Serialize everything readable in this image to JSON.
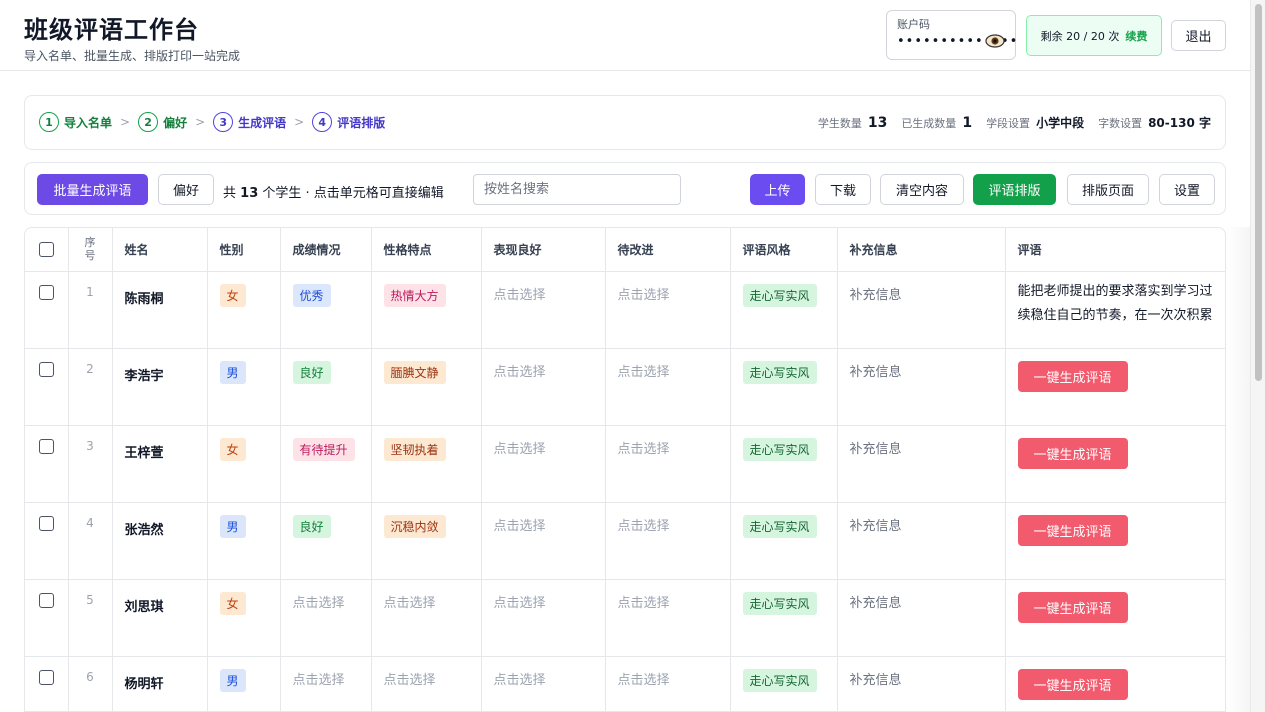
{
  "header": {
    "title": "班级评语工作台",
    "subtitle": "导入名单、批量生成、排版打印一站完成",
    "account_label": "账户码",
    "account_value": "••••••••••••••",
    "quota_text": "剩余 20 / 20 次",
    "renew_label": "续费",
    "logout_label": "退出"
  },
  "steps": {
    "items": [
      {
        "num": "1",
        "label": "导入名单"
      },
      {
        "num": "2",
        "label": "偏好"
      },
      {
        "num": "3",
        "label": "生成评语"
      },
      {
        "num": "4",
        "label": "评语排版"
      }
    ],
    "separator": ">",
    "stats": {
      "students_label": "学生数量",
      "students_value": "13",
      "generated_label": "已生成数量",
      "generated_value": "1",
      "stage_label": "学段设置",
      "stage_value": "小学中段",
      "words_label": "字数设置",
      "words_value": "80-130 字"
    }
  },
  "toolbar": {
    "batch_label": "批量生成评语",
    "pref_label": "偏好",
    "info_prefix": "共",
    "info_count": "13",
    "info_suffix": "个学生 · 点击单元格可直接编辑",
    "search_placeholder": "按姓名搜索",
    "upload_label": "上传",
    "download_label": "下载",
    "clear_label": "清空内容",
    "layout_label": "评语排版",
    "layout_page_label": "排版页面",
    "settings_label": "设置"
  },
  "table": {
    "headers": {
      "no": "序号",
      "name": "姓名",
      "gender": "性别",
      "grade": "成绩情况",
      "personality": "性格特点",
      "good": "表现良好",
      "improve": "待改进",
      "style": "评语风格",
      "extra": "补充信息",
      "comment": "评语"
    },
    "placeholder": "点击选择",
    "extra_placeholder": "补充信息",
    "generate_label": "一键生成评语",
    "rows": [
      {
        "no": "1",
        "name": "陈雨桐",
        "gender": "女",
        "grade": "优秀",
        "personality": "热情大方",
        "good": "点击选择",
        "improve": "点击选择",
        "style": "走心写实风",
        "extra": "补充信息",
        "comment_line1": "能把老师提出的要求落实到学习过",
        "comment_line2": "续稳住自己的节奏，在一次次积累"
      },
      {
        "no": "2",
        "name": "李浩宇",
        "gender": "男",
        "grade": "良好",
        "personality": "腼腆文静",
        "good": "点击选择",
        "improve": "点击选择",
        "style": "走心写实风",
        "extra": "补充信息"
      },
      {
        "no": "3",
        "name": "王梓萱",
        "gender": "女",
        "grade": "有待提升",
        "personality": "坚韧执着",
        "good": "点击选择",
        "improve": "点击选择",
        "style": "走心写实风",
        "extra": "补充信息"
      },
      {
        "no": "4",
        "name": "张浩然",
        "gender": "男",
        "grade": "良好",
        "personality": "沉稳内敛",
        "good": "点击选择",
        "improve": "点击选择",
        "style": "走心写实风",
        "extra": "补充信息"
      },
      {
        "no": "5",
        "name": "刘思琪",
        "gender": "女",
        "grade": "点击选择",
        "personality": "点击选择",
        "good": "点击选择",
        "improve": "点击选择",
        "style": "走心写实风",
        "extra": "补充信息"
      },
      {
        "no": "6",
        "name": "杨明轩",
        "gender": "男",
        "grade": "点击选择",
        "personality": "点击选择",
        "good": "点击选择",
        "improve": "点击选择",
        "style": "走心写实风",
        "extra": "补充信息"
      }
    ]
  },
  "colors": {
    "accent_purple": "#6d4ae6",
    "accent_green": "#13a04a",
    "generate_red": "#f25a6e"
  }
}
